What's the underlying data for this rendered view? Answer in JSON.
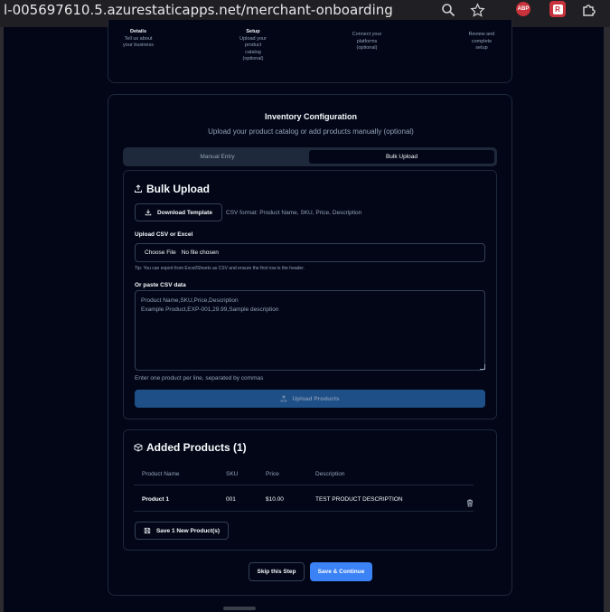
{
  "browser": {
    "url": "l-005697610.5.azurestaticapps.net/merchant-onboarding",
    "zoom_icon": "zoom-icon",
    "star_icon": "star-icon",
    "abp_label": "ABP",
    "ext_label": "R",
    "extensions_icon": "puzzle-icon"
  },
  "stepper": {
    "steps": [
      {
        "title": "Details",
        "desc": "Tell us about\nyour business"
      },
      {
        "title": "Setup",
        "desc": "Upload your\nproduct\ncatalog\n(optional)"
      },
      {
        "title": "",
        "desc": "Connect your\nplatforms\n(optional)"
      },
      {
        "title": "",
        "desc": "Review and\ncomplete\nsetup"
      }
    ]
  },
  "section": {
    "title": "Inventory Configuration",
    "subtitle": "Upload your product catalog or add products manually (optional)"
  },
  "tabs": [
    {
      "label": "Manual Entry",
      "active": false
    },
    {
      "label": "Bulk Upload",
      "active": true
    }
  ],
  "bulk": {
    "title": "Bulk Upload",
    "download_label": "Download Template",
    "csv_format": "CSV format: Product Name, SKU, Price, Description",
    "upload_label": "Upload CSV or Excel",
    "choose_file": "Choose File",
    "no_file": "No file chosen",
    "tip": "Tip: You can export from Excel/Sheets as CSV and ensure the first row is the header.",
    "paste_label": "Or paste CSV data",
    "placeholder": "Product Name,SKU,Price,Description\nExample Product,EXP-001,29.99,Sample description",
    "help": "Enter one product per line, separated by commas",
    "upload_button": "Upload Products"
  },
  "added": {
    "title": "Added Products (1)",
    "columns": [
      "Product Name",
      "SKU",
      "Price",
      "Description"
    ],
    "rows": [
      {
        "name": "Product 1",
        "sku": "001",
        "price": "$10.00",
        "description": "TEST PRODUCT DESCRIPTION"
      }
    ],
    "save_button": "Save 1 New Product(s)"
  },
  "footer": {
    "skip": "Skip this Step",
    "save": "Save & Continue"
  },
  "colors": {
    "background": "#020617",
    "border": "#1e293b",
    "primary": "#3b82f6",
    "upload_disabled": "#1e4f86"
  }
}
